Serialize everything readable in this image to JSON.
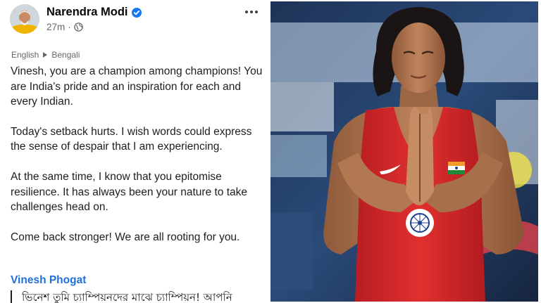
{
  "post": {
    "author": "Narendra Modi",
    "time": "27m",
    "translation": {
      "from": "English",
      "to": "Bengali"
    },
    "paragraphs": [
      "Vinesh, you are a champion among champions! You are India's pride and an inspiration for each and every Indian.",
      "Today's setback hurts. I wish words could express the sense of despair that I am experiencing.",
      "At the same time, I know that you epitomise resilience. It has always been your nature to take challenges head on.",
      "Come back stronger! We are all rooting for you."
    ],
    "tagged": "Vinesh Phogat",
    "quote_preview": "ভিনেশ তুমি চ্যাম্পিয়নদের মাঝে চ্যাম্পিয়ন! আপনি"
  },
  "icons": {
    "verified": "verified-badge-icon",
    "privacy": "globe-icon",
    "more": "more-options-icon",
    "translate_arrow": "arrow-right-icon"
  },
  "colors": {
    "verified_blue": "#1877f2",
    "link_blue": "#216fdb",
    "meta_gray": "#65676b",
    "singlet_red": "#d7262c"
  },
  "image": {
    "description_icon": "photo-of-athlete"
  }
}
